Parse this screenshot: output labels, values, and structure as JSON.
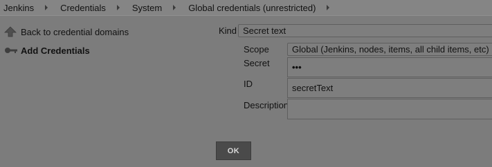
{
  "breadcrumb": {
    "items": [
      "Jenkins",
      "Credentials",
      "System",
      "Global credentials (unrestricted)"
    ]
  },
  "sidebar": {
    "back_label": "Back to credential domains",
    "add_label": "Add Credentials"
  },
  "form": {
    "kind_label": "Kind",
    "kind_value": "Secret text",
    "scope_label": "Scope",
    "scope_value": "Global (Jenkins, nodes, items, all child items, etc)",
    "secret_label": "Secret",
    "secret_value": "•••",
    "id_label": "ID",
    "id_value": "secretText",
    "description_label": "Description",
    "description_value": ""
  },
  "actions": {
    "ok_label": "OK"
  },
  "colors": {
    "overlay": "#7c7c7c",
    "button": "#4a4a4a"
  }
}
